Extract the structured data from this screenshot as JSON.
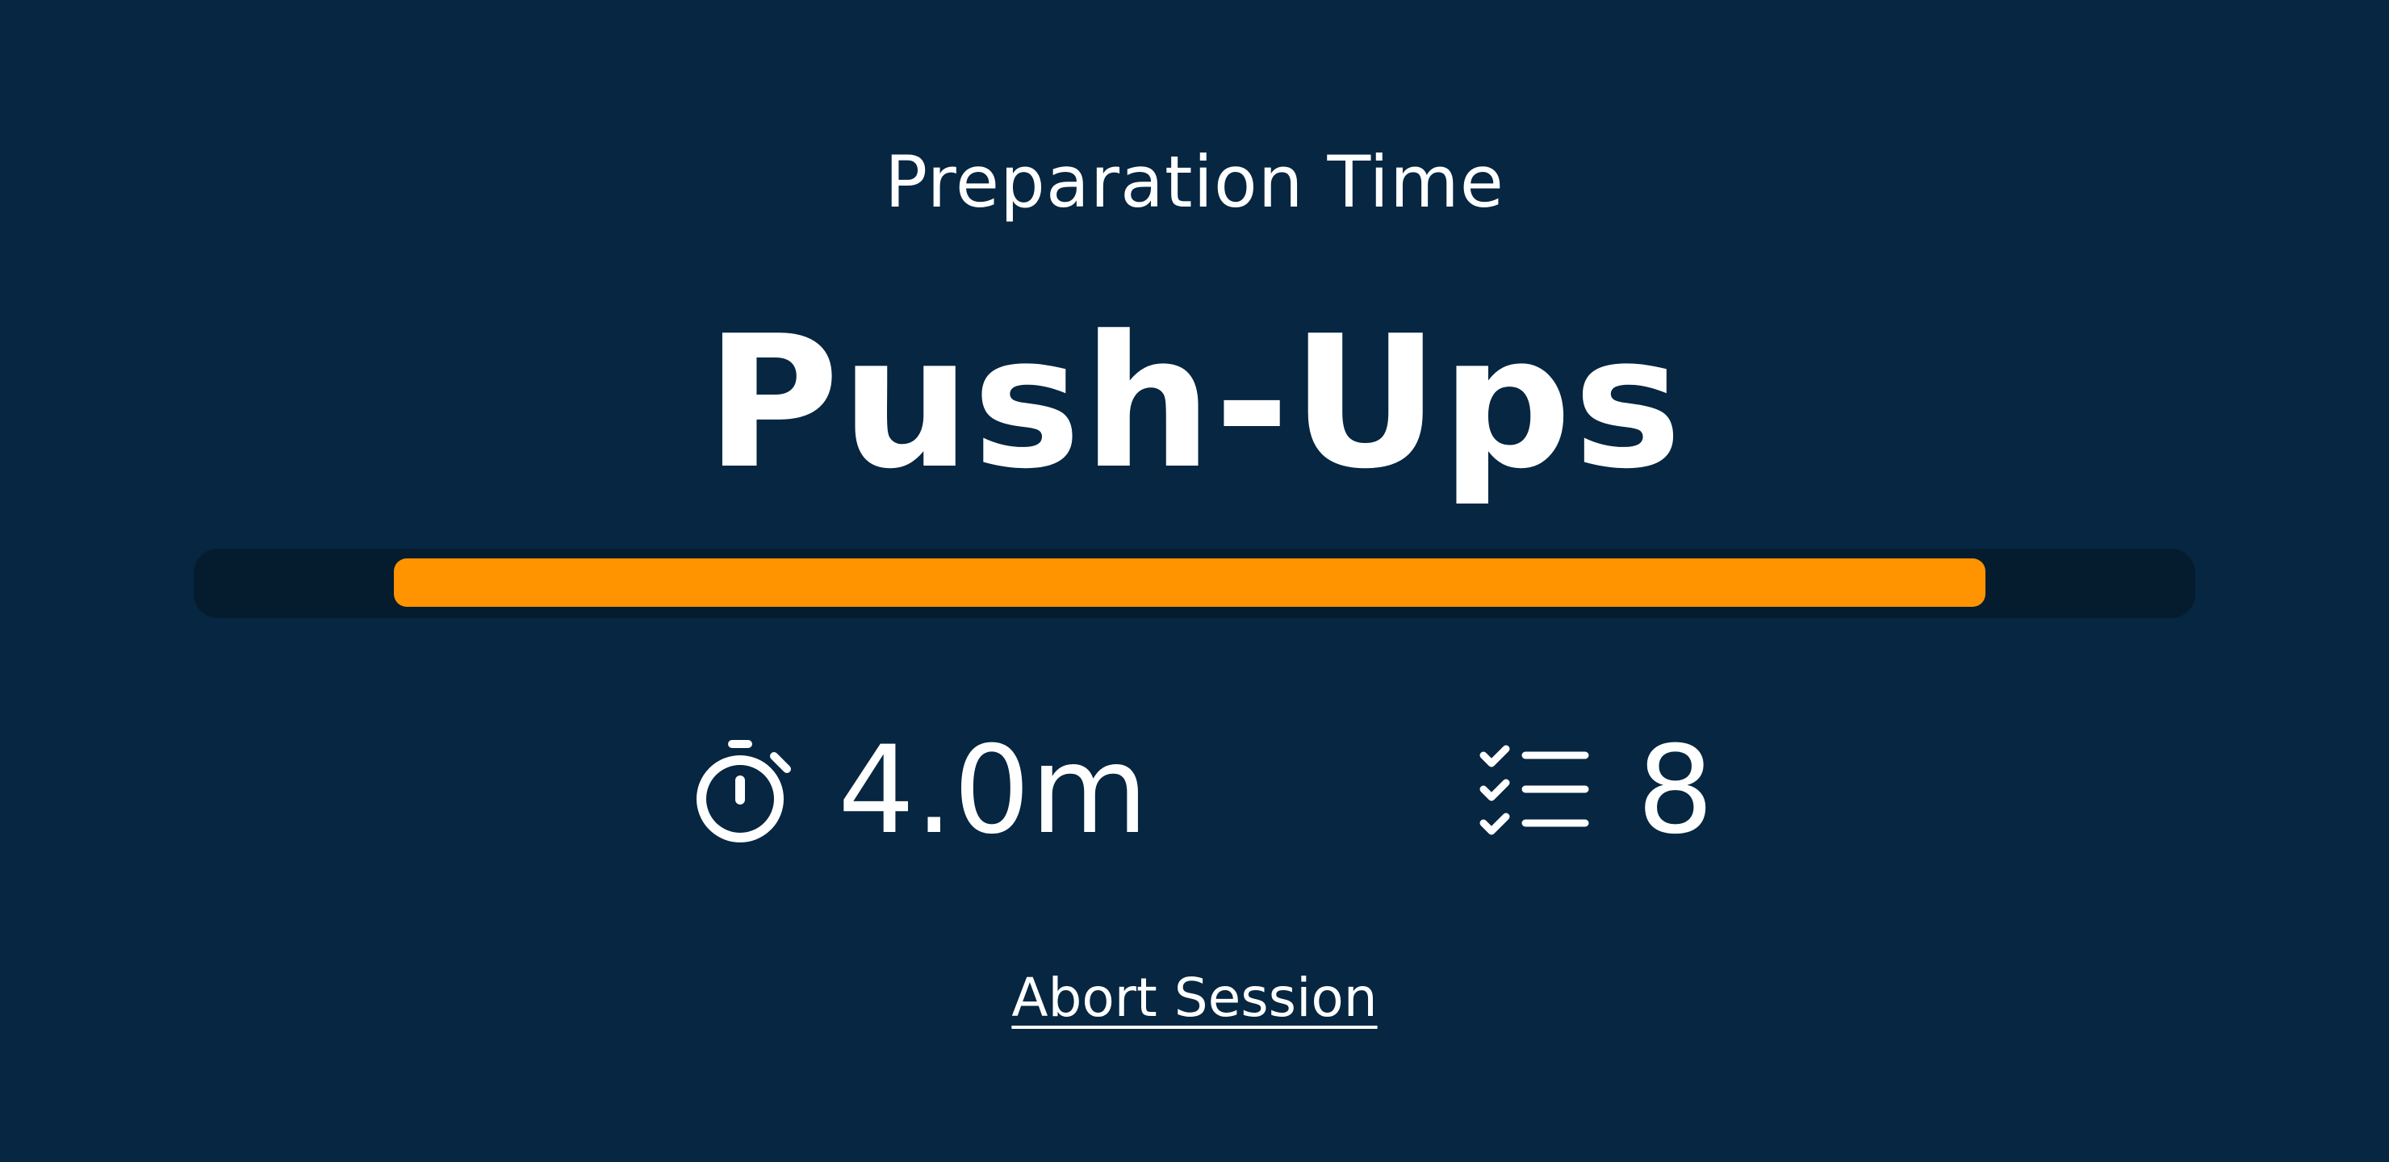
{
  "session": {
    "phase_label": "Preparation Time",
    "exercise_name": "Push-Ups",
    "progress": {
      "start_fraction": 0.1,
      "end_fraction": 0.895,
      "fill_color": "#ff9300",
      "track_color": "#041c2e"
    },
    "duration": {
      "icon": "stopwatch-icon",
      "value": "4.0m"
    },
    "sets": {
      "icon": "checklist-icon",
      "value": "8"
    },
    "abort_label": "Abort Session"
  },
  "theme": {
    "background": "#062641",
    "text": "#ffffff"
  }
}
